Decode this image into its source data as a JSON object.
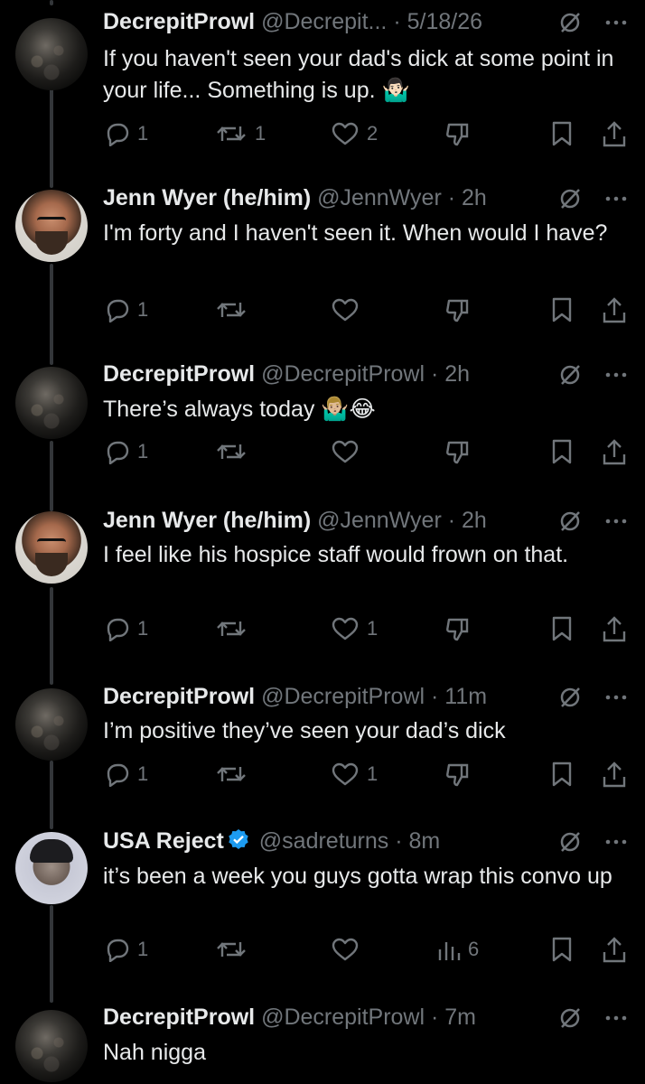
{
  "tweets": [
    {
      "name": "DecrepitProwl",
      "handle": "@Decrepit...",
      "time": "5/18/26",
      "text": "If you haven't seen your dad's dick at some point in your life... Something is up. 🤷🏻‍♂️",
      "replies": "1",
      "reposts": "1",
      "likes": "2",
      "views": "",
      "avatar": "decrepit",
      "verified": false,
      "view_icon": "dislike"
    },
    {
      "name": "Jenn Wyer (he/him)",
      "handle": "@JennWyer",
      "time": "2h",
      "text": "I'm forty and I haven't seen it. When would I have?",
      "replies": "1",
      "reposts": "",
      "likes": "",
      "views": "",
      "avatar": "jenn",
      "verified": false,
      "view_icon": "dislike"
    },
    {
      "name": "DecrepitProwl",
      "handle": "@DecrepitProwl",
      "time": "2h",
      "text": "There’s always today 🤷🏼‍♂️😂",
      "replies": "1",
      "reposts": "",
      "likes": "",
      "views": "",
      "avatar": "decrepit",
      "verified": false,
      "view_icon": "dislike"
    },
    {
      "name": "Jenn Wyer (he/him)",
      "handle": "@JennWyer",
      "time": "2h",
      "text": "I feel like his hospice staff would frown on that.",
      "replies": "1",
      "reposts": "",
      "likes": "1",
      "views": "",
      "avatar": "jenn",
      "verified": false,
      "view_icon": "dislike"
    },
    {
      "name": "DecrepitProwl",
      "handle": "@DecrepitProwl",
      "time": "11m",
      "text": "I’m positive they’ve seen your dad’s dick",
      "replies": "1",
      "reposts": "",
      "likes": "1",
      "views": "",
      "avatar": "decrepit",
      "verified": false,
      "view_icon": "dislike"
    },
    {
      "name": "USA Reject",
      "handle": "@sadreturns",
      "time": "8m",
      "text": "it’s been a week you guys gotta wrap this convo up",
      "replies": "1",
      "reposts": "",
      "likes": "",
      "views": "6",
      "avatar": "usa",
      "verified": true,
      "view_icon": "views"
    },
    {
      "name": "DecrepitProwl",
      "handle": "@DecrepitProwl",
      "time": "7m",
      "text": "Nah nigga",
      "replies": "",
      "reposts": "",
      "likes": "",
      "views": "",
      "avatar": "decrepit",
      "verified": false,
      "view_icon": "none"
    }
  ],
  "separator": " · ",
  "colors": {
    "background": "#000000",
    "text": "#e7e9ea",
    "muted": "#71767b",
    "verified": "#1d9bf0",
    "thread_line": "#333639"
  },
  "icons": [
    "reply-icon",
    "repost-icon",
    "like-icon",
    "dislike-icon",
    "views-icon",
    "bookmark-icon",
    "share-icon",
    "grok-icon",
    "more-icon",
    "verified-badge-icon"
  ]
}
